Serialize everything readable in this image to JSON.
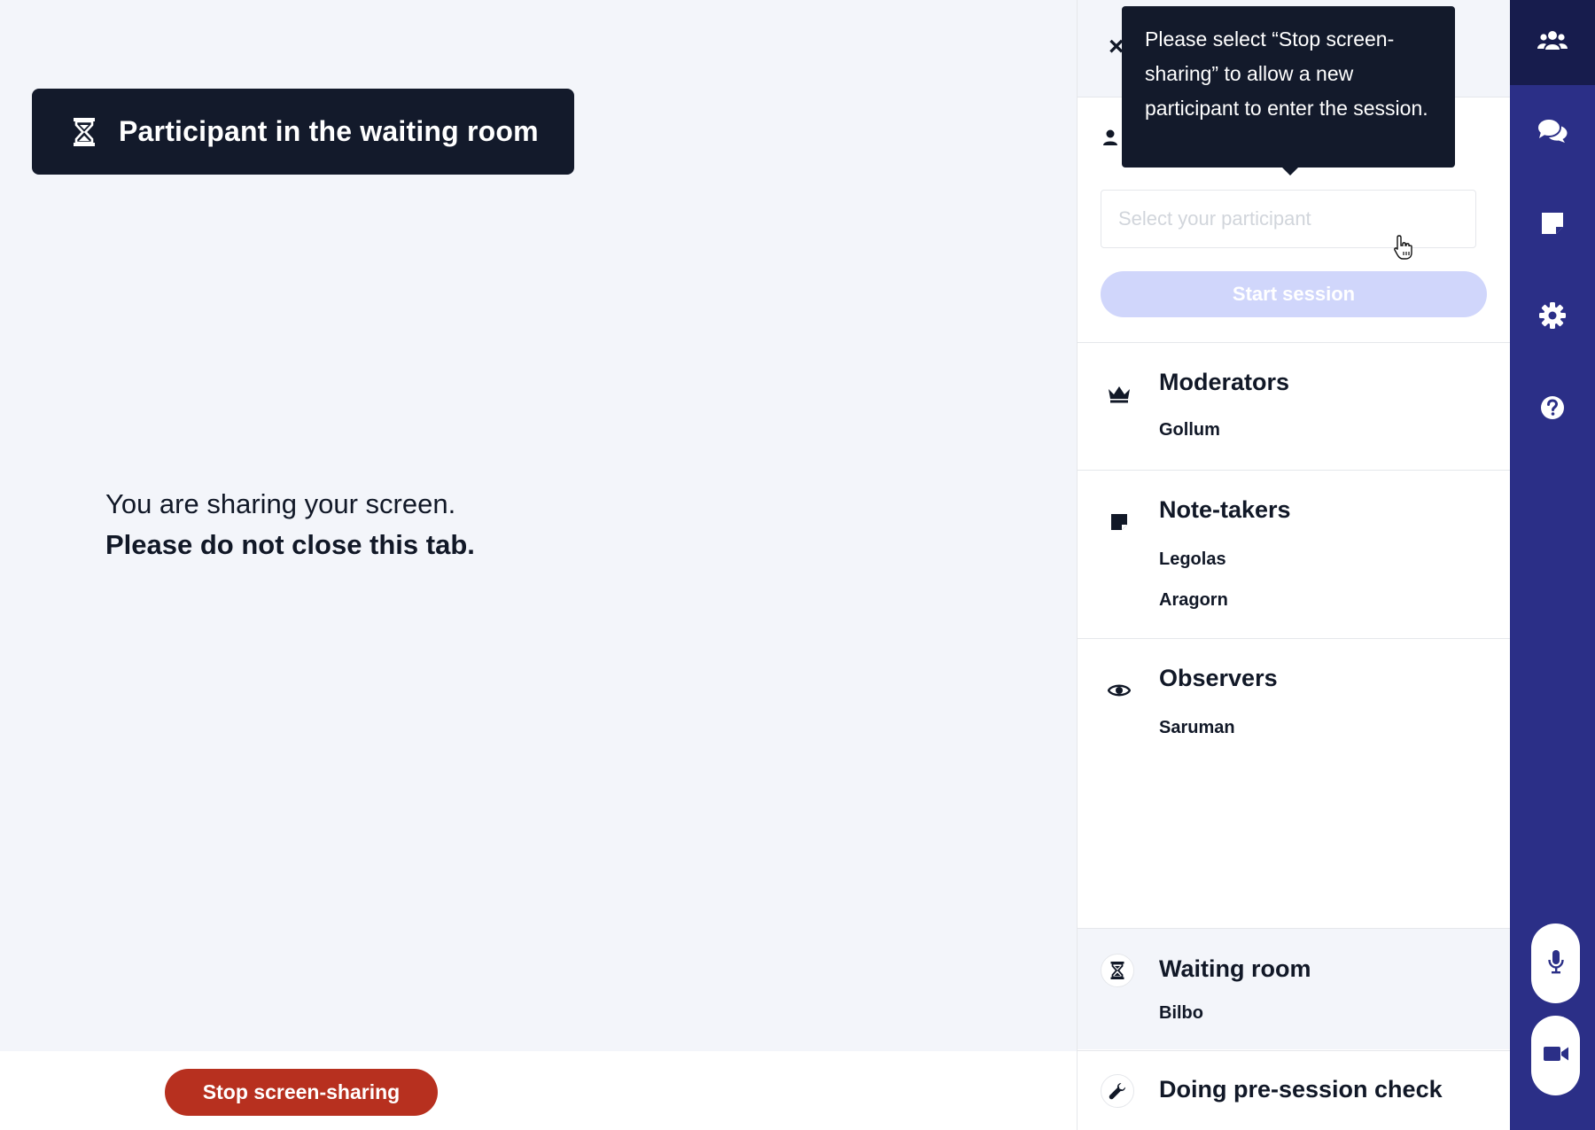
{
  "banner": {
    "text": "Participant in the waiting room",
    "icon": "hourglass-icon"
  },
  "sharing": {
    "line1": "You are sharing your screen.",
    "line2": "Please do not close this tab."
  },
  "stop_button": {
    "label": "Stop screen-sharing",
    "color": "#b7301f"
  },
  "panel": {
    "close_label": "×",
    "participant_select": {
      "placeholder": "Select your participant"
    },
    "start_button": {
      "label": "Start session",
      "color": "#d0d6fb"
    },
    "moderators": {
      "title": "Moderators",
      "icon": "crown-icon",
      "members": [
        "Gollum"
      ]
    },
    "note_takers": {
      "title": "Note-takers",
      "icon": "sticky-note-icon",
      "members": [
        "Legolas",
        "Aragorn"
      ]
    },
    "observers": {
      "title": "Observers",
      "icon": "eye-icon",
      "members": [
        "Saruman"
      ]
    },
    "waiting_room": {
      "title": "Waiting room",
      "icon": "hourglass-icon",
      "members": [
        "Bilbo"
      ]
    },
    "pre_session": {
      "title": "Doing pre-session check",
      "icon": "wrench-icon"
    }
  },
  "tooltip": {
    "text": "Please select “Stop screen-sharing” to allow a new participant to enter the session."
  },
  "nav": {
    "color": "#2b2f87",
    "active_color": "#171c4d",
    "items": [
      "participants-icon",
      "chat-icon",
      "notes-icon",
      "settings-icon",
      "help-icon"
    ],
    "controls": [
      "microphone-icon",
      "camera-icon"
    ]
  }
}
